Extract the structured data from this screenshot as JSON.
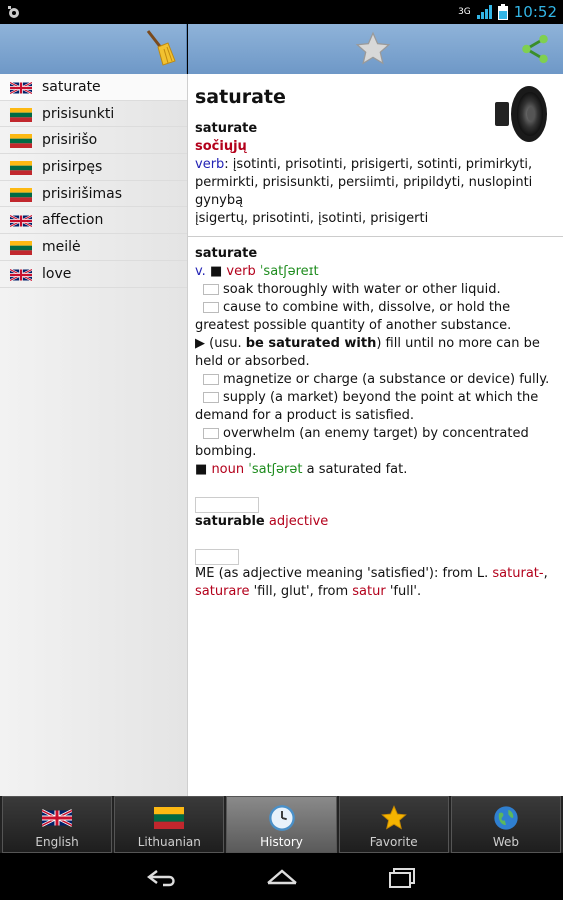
{
  "status_bar": {
    "network": "3G",
    "time": "10:52",
    "icons": [
      "debug-icon",
      "signal-icon",
      "battery-icon"
    ]
  },
  "toolbar": {
    "left_icon": "broom-icon",
    "center_icon": "star-icon",
    "right_icon": "share-icon"
  },
  "history": {
    "items": [
      {
        "word": "saturate",
        "flag": "uk"
      },
      {
        "word": "prisisunkti",
        "flag": "lt"
      },
      {
        "word": "prisirišo",
        "flag": "lt"
      },
      {
        "word": "prisirpęs",
        "flag": "lt"
      },
      {
        "word": "prisirišimas",
        "flag": "lt"
      },
      {
        "word": "affection",
        "flag": "uk"
      },
      {
        "word": "meilė",
        "flag": "lt"
      },
      {
        "word": "love",
        "flag": "uk"
      }
    ]
  },
  "entry": {
    "headword": "saturate",
    "section1": {
      "title": "saturate",
      "translation": "sočiųjų",
      "pos": "verb",
      "line1": ": įsotinti, prisotinti, prisigerti, sotinti, primirkyti, permirkti, prisisunkti, persiimti, pripildyti, nuslopinti gynybą",
      "line2": "įsigertų, prisotinti, įsotinti, prisigerti"
    },
    "section2": {
      "title": "saturate",
      "abbr": "v.",
      "bullet": "■",
      "pos": "verb",
      "pron": "ˈsatʃəreɪt",
      "senses": [
        "soak thoroughly with water or other liquid.",
        "cause to combine with, dissolve, or hold the greatest possible quantity of another substance."
      ],
      "arrow": "▶",
      "usu_pre": "(usu. ",
      "usu_bold": "be saturated with",
      "usu_post": ") fill until no more can be held or absorbed.",
      "senses2": [
        "magnetize or charge (a substance or device) fully.",
        "supply (a market) beyond the point at which the demand for a product is satisfied.",
        "overwhelm (an enemy target) by concentrated bombing."
      ],
      "noun_pos": "noun",
      "noun_pron": "ˈsatʃərət",
      "noun_def": " a saturated fat."
    },
    "derivative": {
      "word": "saturable",
      "pos": "adjective"
    },
    "origin": {
      "pre": "ME (as adjective meaning 'satisfied'): from L. ",
      "w1": "saturat-",
      "sep1": ", ",
      "w2": "saturare",
      "mid": " 'fill, glut', from ",
      "w3": "satur",
      "post": " 'full'."
    }
  },
  "tabs": [
    {
      "label": "English",
      "icon": "uk-flag-icon"
    },
    {
      "label": "Lithuanian",
      "icon": "lt-flag-icon"
    },
    {
      "label": "History",
      "icon": "clock-icon",
      "active": true
    },
    {
      "label": "Favorite",
      "icon": "star-icon"
    },
    {
      "label": "Web",
      "icon": "globe-icon"
    }
  ],
  "navbar": {
    "icons": [
      "back-icon",
      "home-icon",
      "recent-apps-icon"
    ]
  },
  "colors": {
    "toolbar": "#7ba3d0",
    "accent_blue": "#33b5e5",
    "pos_red": "#b3001b",
    "pron_green": "#1e8c1e",
    "link_blue": "#2323b5"
  }
}
